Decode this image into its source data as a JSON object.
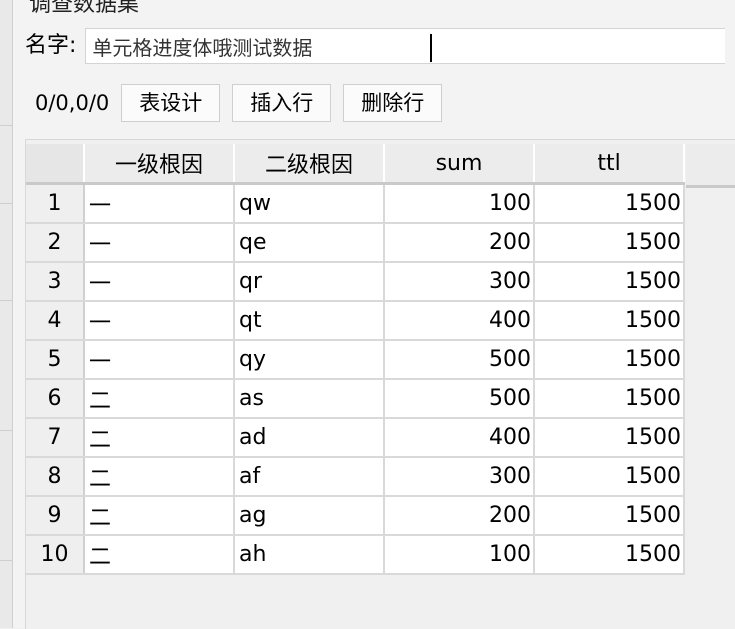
{
  "window": {
    "title_partial": "调查数据集"
  },
  "name_field": {
    "label": "名字:",
    "value": "单元格进度体哦测试数据"
  },
  "toolbar": {
    "counter": "0/0,0/0",
    "design_label": "表设计",
    "insert_row_label": "插入行",
    "delete_row_label": "删除行"
  },
  "table": {
    "columns": [
      "一级根因",
      "二级根因",
      "sum",
      "ttl"
    ],
    "rows": [
      {
        "num": "1",
        "c1": "一",
        "c2": "qw",
        "sum": "100",
        "ttl": "1500"
      },
      {
        "num": "2",
        "c1": "一",
        "c2": "qe",
        "sum": "200",
        "ttl": "1500"
      },
      {
        "num": "3",
        "c1": "一",
        "c2": "qr",
        "sum": "300",
        "ttl": "1500"
      },
      {
        "num": "4",
        "c1": "一",
        "c2": "qt",
        "sum": "400",
        "ttl": "1500"
      },
      {
        "num": "5",
        "c1": "一",
        "c2": "qy",
        "sum": "500",
        "ttl": "1500"
      },
      {
        "num": "6",
        "c1": "二",
        "c2": "as",
        "sum": "500",
        "ttl": "1500"
      },
      {
        "num": "7",
        "c1": "二",
        "c2": "ad",
        "sum": "400",
        "ttl": "1500"
      },
      {
        "num": "8",
        "c1": "二",
        "c2": "af",
        "sum": "300",
        "ttl": "1500"
      },
      {
        "num": "9",
        "c1": "二",
        "c2": "ag",
        "sum": "200",
        "ttl": "1500"
      },
      {
        "num": "10",
        "c1": "二",
        "c2": "ah",
        "sum": "100",
        "ttl": "1500"
      }
    ]
  }
}
